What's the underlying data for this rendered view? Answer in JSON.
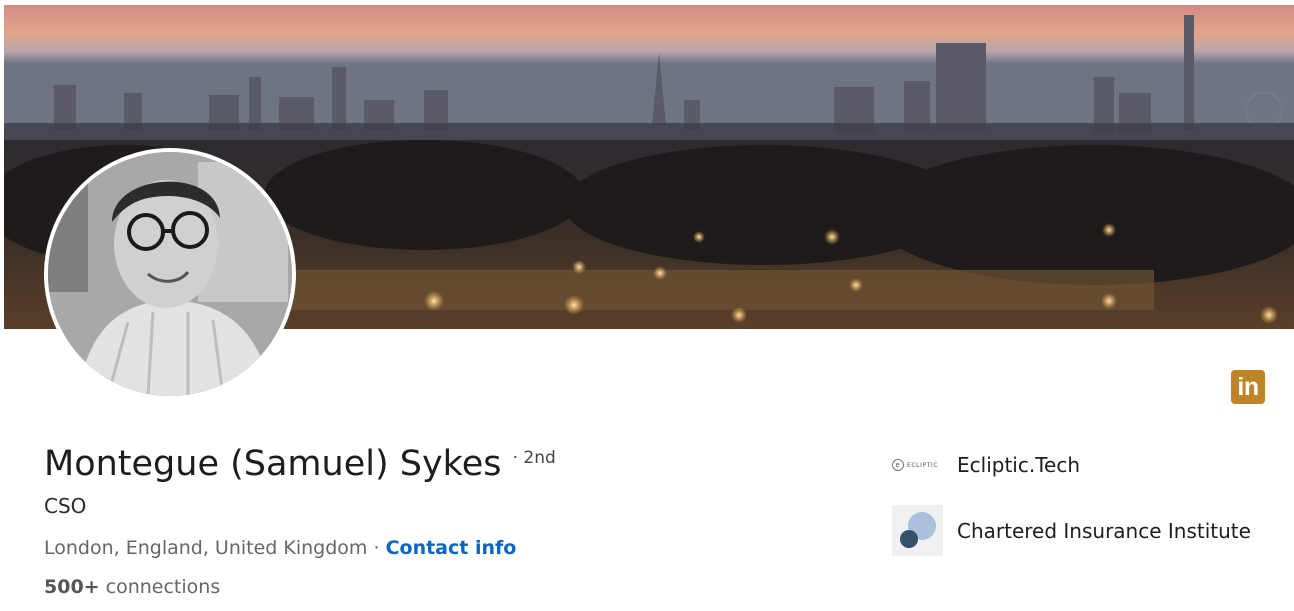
{
  "profile": {
    "name": "Montegue (Samuel) Sykes",
    "degree": "· 2nd",
    "headline": "CSO",
    "location": "London, England, United Kingdom",
    "separator": "·",
    "contact_label": "Contact info",
    "connections_count": "500+",
    "connections_label": "connections"
  },
  "linkedin_icon": {
    "label": "in",
    "color": "#c08428"
  },
  "organizations": [
    {
      "name": "Ecliptic.Tech",
      "logo_text": "ECLIPTIC",
      "logo_mark": "e"
    },
    {
      "name": "Chartered Insurance Institute"
    }
  ],
  "colors": {
    "link": "#0a66c2",
    "text": "#1d1d1d",
    "muted": "#666666"
  }
}
